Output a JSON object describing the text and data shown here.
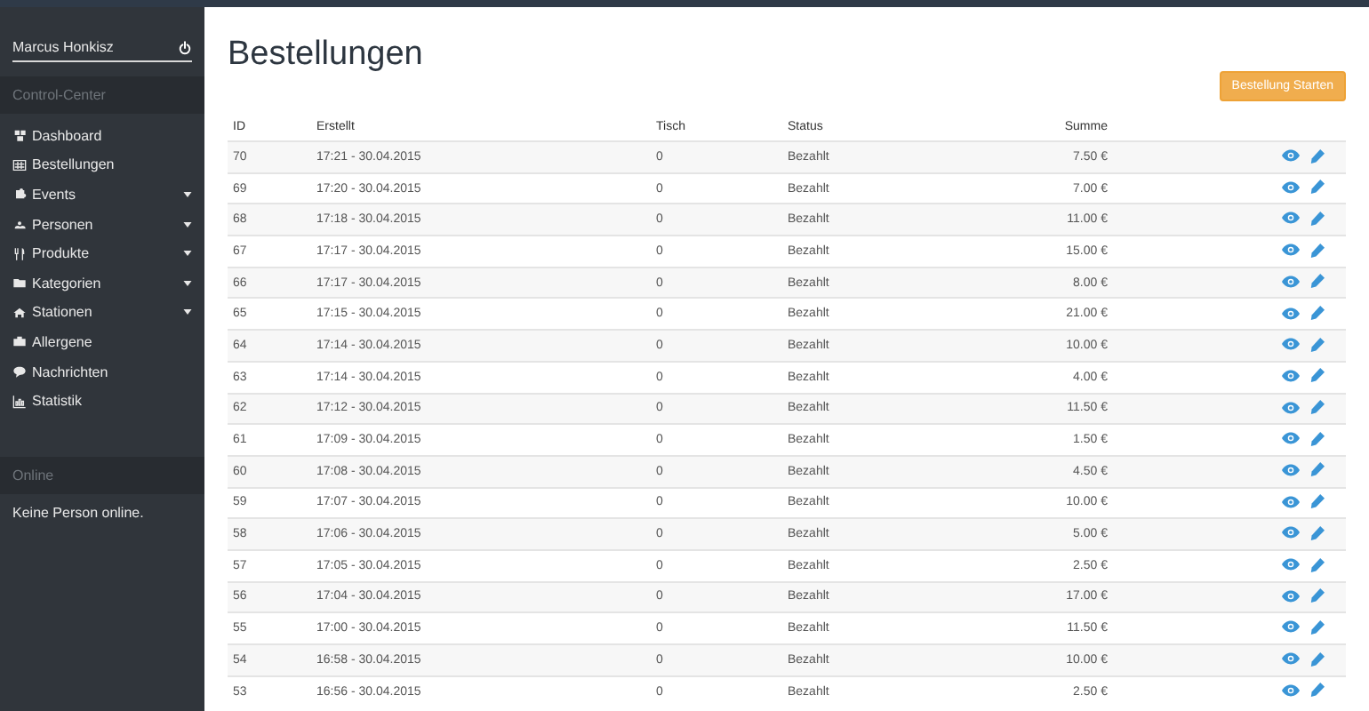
{
  "sidebar": {
    "user": "Marcus Honkisz",
    "section_title": "Control-Center",
    "items": [
      {
        "label": "Dashboard",
        "has_submenu": false
      },
      {
        "label": "Bestellungen",
        "has_submenu": false
      },
      {
        "label": "Events",
        "has_submenu": true
      },
      {
        "label": "Personen",
        "has_submenu": true
      },
      {
        "label": "Produkte",
        "has_submenu": true
      },
      {
        "label": "Kategorien",
        "has_submenu": true
      },
      {
        "label": "Stationen",
        "has_submenu": true
      },
      {
        "label": "Allergene",
        "has_submenu": false
      },
      {
        "label": "Nachrichten",
        "has_submenu": false
      },
      {
        "label": "Statistik",
        "has_submenu": false
      }
    ],
    "online_title": "Online",
    "online_text": "Keine Person online."
  },
  "page": {
    "title": "Bestellungen",
    "primary_button": "Bestellung Starten"
  },
  "table": {
    "columns": [
      "ID",
      "Erstellt",
      "Tisch",
      "Status",
      "Summe"
    ],
    "rows": [
      [
        "70",
        "17:21 - 30.04.2015",
        "0",
        "Bezahlt",
        "7.50 €"
      ],
      [
        "69",
        "17:20 - 30.04.2015",
        "0",
        "Bezahlt",
        "7.00 €"
      ],
      [
        "68",
        "17:18 - 30.04.2015",
        "0",
        "Bezahlt",
        "11.00 €"
      ],
      [
        "67",
        "17:17 - 30.04.2015",
        "0",
        "Bezahlt",
        "15.00 €"
      ],
      [
        "66",
        "17:17 - 30.04.2015",
        "0",
        "Bezahlt",
        "8.00 €"
      ],
      [
        "65",
        "17:15 - 30.04.2015",
        "0",
        "Bezahlt",
        "21.00 €"
      ],
      [
        "64",
        "17:14 - 30.04.2015",
        "0",
        "Bezahlt",
        "10.00 €"
      ],
      [
        "63",
        "17:14 - 30.04.2015",
        "0",
        "Bezahlt",
        "4.00 €"
      ],
      [
        "62",
        "17:12 - 30.04.2015",
        "0",
        "Bezahlt",
        "11.50 €"
      ],
      [
        "61",
        "17:09 - 30.04.2015",
        "0",
        "Bezahlt",
        "1.50 €"
      ],
      [
        "60",
        "17:08 - 30.04.2015",
        "0",
        "Bezahlt",
        "4.50 €"
      ],
      [
        "59",
        "17:07 - 30.04.2015",
        "0",
        "Bezahlt",
        "10.00 €"
      ],
      [
        "58",
        "17:06 - 30.04.2015",
        "0",
        "Bezahlt",
        "5.00 €"
      ],
      [
        "57",
        "17:05 - 30.04.2015",
        "0",
        "Bezahlt",
        "2.50 €"
      ],
      [
        "56",
        "17:04 - 30.04.2015",
        "0",
        "Bezahlt",
        "17.00 €"
      ],
      [
        "55",
        "17:00 - 30.04.2015",
        "0",
        "Bezahlt",
        "11.50 €"
      ],
      [
        "54",
        "16:58 - 30.04.2015",
        "0",
        "Bezahlt",
        "10.00 €"
      ],
      [
        "53",
        "16:56 - 30.04.2015",
        "0",
        "Bezahlt",
        "2.50 €"
      ]
    ]
  }
}
